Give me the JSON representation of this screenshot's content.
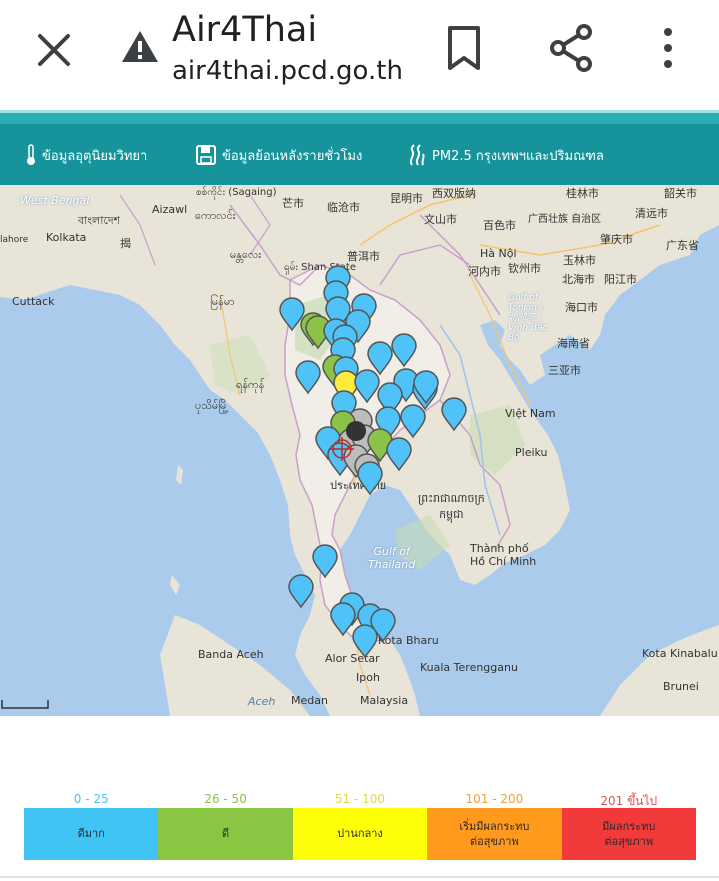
{
  "browser": {
    "title": "Air4Thai",
    "url": "air4thai.pcd.go.th",
    "icons": [
      "close-icon",
      "warning-icon",
      "bookmark-icon",
      "share-icon",
      "more-vert-icon"
    ]
  },
  "nav": {
    "items": [
      {
        "label": "ข้อมูลอุตุนิยมวิทยา",
        "icon": "thermometer-icon"
      },
      {
        "label": "ข้อมูลย้อนหลังรายชั่วโมง",
        "icon": "floppy-disk-icon"
      },
      {
        "label": "PM2.5 กรุงเทพฯและปริมณฑล",
        "icon": "smoke-icon"
      }
    ]
  },
  "map": {
    "labels": {
      "west_bengal": "West Bengal",
      "bangladesh": "বাংলাদেশ",
      "kolkata": "Kolkata",
      "aizawl": "Aizawl",
      "sagaing": "စစ်ကိုင်း\n(Sagaing)",
      "kawlin": "ကောလင်း",
      "mandalay": "မန္တလေး",
      "shan": "ရှမ်း\nShan State",
      "myanmar": "မြန်မာ",
      "yangon": "ရန်ကုန်",
      "bago": "ပုသိမ်မြို့",
      "cuttack": "Cuttack",
      "gejiu": "芒市",
      "lincang": "临沧市",
      "puer": "普洱市",
      "kunming": "昆明市",
      "xishuangbanna": "西双版纳",
      "wenshan": "文山市",
      "baise": "百色市",
      "guangxi": "广西壮族\n自治区",
      "guilin": "桂林市",
      "shaoguan": "韶关市",
      "qingyuan": "清远市",
      "zhaoqing": "肇庆市",
      "guangdong": "广东省",
      "yulin": "玉林市",
      "qinzhou": "钦州市",
      "beihai": "北海市",
      "yangjiang": "阳江市",
      "haikou": "海口市",
      "hainan": "海南省",
      "sanya": "三亚市",
      "hanoi": "Hà Nội",
      "hanoi_cn": "河内市",
      "gulf_tonkin": "Gulf of\nTonkin /\n北部湾 /\nVịnh Bắc\nBộ",
      "vietnam": "Việt Nam",
      "pleiku": "Pleiku",
      "thailand": "ประเทศไทย",
      "cambodia": "ព្រះរាជាណាចក្រ\nកម្ពុជា",
      "gulf_thailand": "Gulf of\nThailand",
      "hcmc": "Thành phố\nHồ Chí Minh",
      "kota_bharu": "Kota Bharu",
      "alor_setar": "Alor Setar",
      "kuala_terengganu": "Kuala Terengganu",
      "ipoh": "Ipoh",
      "malaysia": "Malaysia",
      "banda_aceh": "Banda Aceh",
      "aceh": "Aceh",
      "medan": "Medan",
      "kota_kinabalu": "Kota Kinabalu",
      "brunei": "Brunei",
      "lahore": "lahore",
      "jie": "揭"
    },
    "marker_colors": {
      "blue": "#4fc3f7",
      "green": "#8bc34a",
      "yellow": "#ffeb3b",
      "gray": "#bdbdbd"
    }
  },
  "legend": {
    "items": [
      {
        "range": "0 - 25",
        "label": "ดีมาก",
        "color": "#3fc4f4",
        "range_color": "#4fc3f7"
      },
      {
        "range": "26 - 50",
        "label": "ดี",
        "color": "#8bc642",
        "range_color": "#8bc34a"
      },
      {
        "range": "51 - 100",
        "label": "ปานกลาง",
        "color": "#fffe09",
        "range_color": "#e0d84a"
      },
      {
        "range": "101 - 200",
        "label": "เริ่มมีผลกระทบ\nต่อสุขภาพ",
        "color": "#ff9a1d",
        "range_color": "#f0a040"
      },
      {
        "range": "201 ขึ้นไป",
        "label": "มีผลกระทบ\nต่อสุขภาพ",
        "color": "#f23a3a",
        "range_color": "#e05050"
      }
    ]
  }
}
